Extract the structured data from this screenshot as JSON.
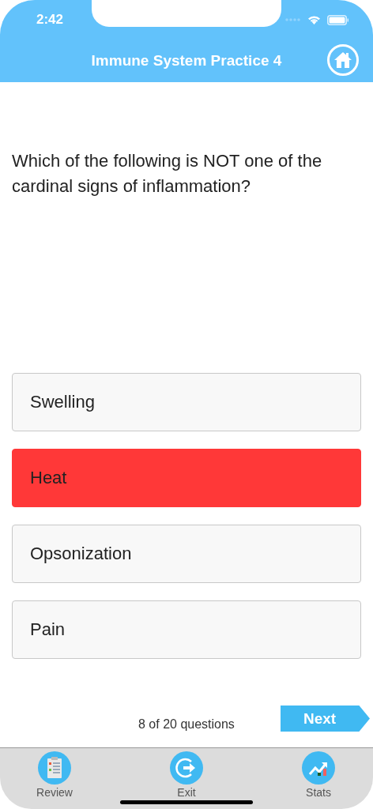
{
  "status_bar": {
    "time": "2:42"
  },
  "nav": {
    "title": "Immune System Practice 4"
  },
  "question": "Which of the following is NOT one of the cardinal signs of inflammation?",
  "answers": [
    {
      "label": "Swelling",
      "selected": false
    },
    {
      "label": "Heat",
      "selected": true
    },
    {
      "label": "Opsonization",
      "selected": false
    },
    {
      "label": "Pain",
      "selected": false
    }
  ],
  "progress": "8 of 20 questions",
  "next_button": "Next",
  "tab_bar": [
    {
      "kind": "review",
      "label": "Review"
    },
    {
      "kind": "exit",
      "label": "Exit"
    },
    {
      "kind": "stats",
      "label": "Stats"
    }
  ]
}
